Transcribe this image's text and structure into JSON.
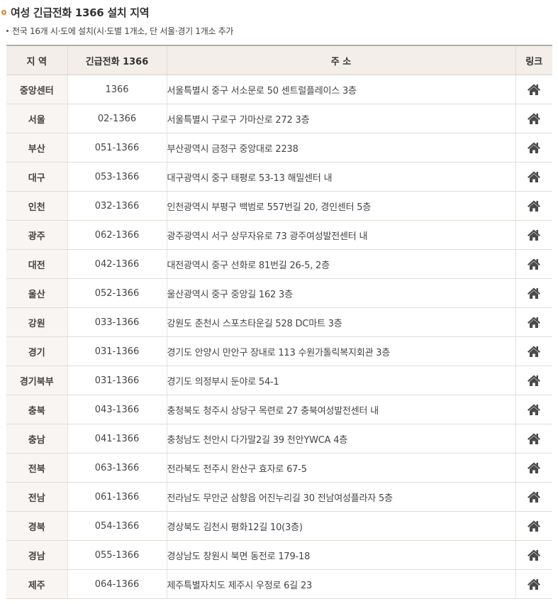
{
  "header": {
    "title": "여성 긴급전화 1366 설치 지역",
    "subtitle": "전국 16개 시·도에 설치(시·도별 1개소, 단 서울·경기 1개소 추가"
  },
  "table": {
    "columns": [
      "지 역",
      "긴급전화 1366",
      "주 소",
      "링크"
    ],
    "rows": [
      {
        "region": "중앙센터",
        "phone": "1366",
        "address": "서울특별시 중구 서소문로 50 센트럴플레이스 3층",
        "link_icon": "home-icon"
      },
      {
        "region": "서울",
        "phone": "02-1366",
        "address": "서울특별시 구로구 가마산로 272 3층",
        "link_icon": "home-icon"
      },
      {
        "region": "부산",
        "phone": "051-1366",
        "address": "부산광역시 금정구 중앙대로 2238",
        "link_icon": "home-icon"
      },
      {
        "region": "대구",
        "phone": "053-1366",
        "address": "대구광역시 중구 태평로 53-13 해밀센터 내",
        "link_icon": "home-icon"
      },
      {
        "region": "인천",
        "phone": "032-1366",
        "address": "인천광역시 부평구 백범로 557번길 20, 경인센터 5층",
        "link_icon": "home-icon"
      },
      {
        "region": "광주",
        "phone": "062-1366",
        "address": "광주광역시 서구 상무자유로 73 광주여성발전센터 내",
        "link_icon": "home-icon"
      },
      {
        "region": "대전",
        "phone": "042-1366",
        "address": "대전광역시 중구 선화로 81번길 26-5, 2층",
        "link_icon": "home-icon"
      },
      {
        "region": "울산",
        "phone": "052-1366",
        "address": "울산광역시 중구 중앙길 162 3층",
        "link_icon": "home-icon"
      },
      {
        "region": "강원",
        "phone": "033-1366",
        "address": "강원도 춘천시 스포츠타운길 528 DC마트 3층",
        "link_icon": "home-icon"
      },
      {
        "region": "경기",
        "phone": "031-1366",
        "address": "경기도 안양시 만안구 장내로 113 수원가톨릭복지회관 3층",
        "link_icon": "home-icon"
      },
      {
        "region": "경기북부",
        "phone": "031-1366",
        "address": "경기도 의정부시 둔야로 54-1",
        "link_icon": "home-icon"
      },
      {
        "region": "충북",
        "phone": "043-1366",
        "address": "충청북도 청주시 상당구 목련로 27 충북여성발전센터 내",
        "link_icon": "home-icon"
      },
      {
        "region": "충남",
        "phone": "041-1366",
        "address": "충청남도 천안시 다가말2길 39 천안YWCA 4층",
        "link_icon": "home-icon"
      },
      {
        "region": "전북",
        "phone": "063-1366",
        "address": "전라북도 전주시 완산구 효자로 67-5",
        "link_icon": "home-icon"
      },
      {
        "region": "전남",
        "phone": "061-1366",
        "address": "전라남도 무안군 삼향읍 어진누리길 30 전남여성플라자 5층",
        "link_icon": "home-icon"
      },
      {
        "region": "경북",
        "phone": "054-1366",
        "address": "경상북도 김천시 평화12길 10(3층)",
        "link_icon": "home-icon"
      },
      {
        "region": "경남",
        "phone": "055-1366",
        "address": "경상남도 창원시 북면 동전로 179-18",
        "link_icon": "home-icon"
      },
      {
        "region": "제주",
        "phone": "064-1366",
        "address": "제주특별자치도 제주시 우정로 6길 23",
        "link_icon": "home-icon"
      }
    ]
  },
  "colors": {
    "title_bullet": "#d9822b",
    "header_bg": "#f3eeea",
    "region_bg": "#f8f5f2",
    "icon": "#4a4a4a"
  }
}
